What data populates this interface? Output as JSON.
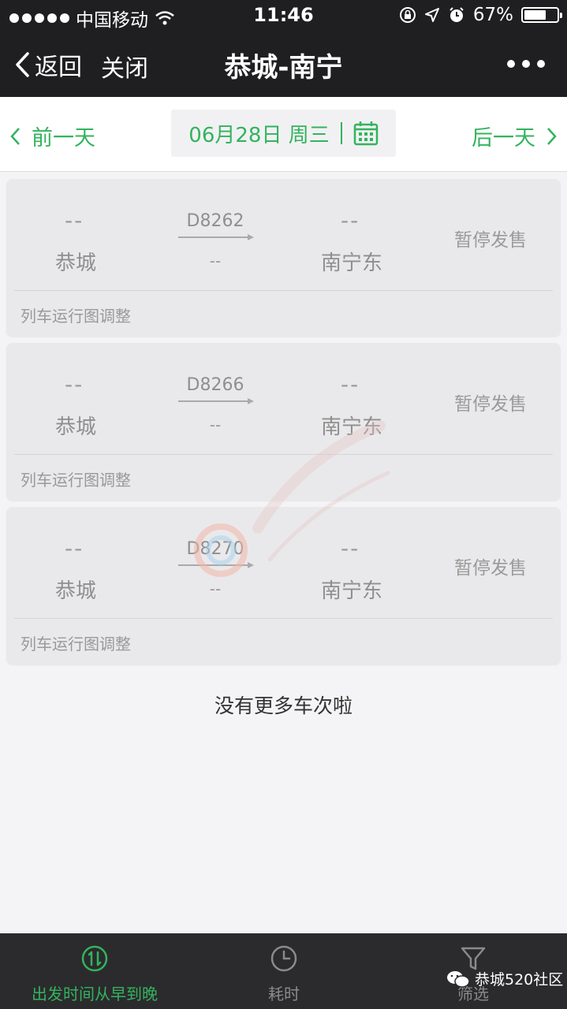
{
  "status_bar": {
    "carrier": "中国移动",
    "time": "11:46",
    "battery": "67%",
    "battery_level": 0.67
  },
  "nav": {
    "back_label": "返回",
    "close_label": "关闭",
    "title": "恭城-南宁"
  },
  "date_bar": {
    "prev_label": "前一天",
    "date_label": "06月28日 周三",
    "next_label": "后一天"
  },
  "trains": [
    {
      "dep_time": "--",
      "dep_station": "恭城",
      "train_no": "D8262",
      "duration": "--",
      "arr_time": "--",
      "arr_station": "南宁东",
      "status": "暂停发售",
      "note": "列车运行图调整"
    },
    {
      "dep_time": "--",
      "dep_station": "恭城",
      "train_no": "D8266",
      "duration": "--",
      "arr_time": "--",
      "arr_station": "南宁东",
      "status": "暂停发售",
      "note": "列车运行图调整"
    },
    {
      "dep_time": "--",
      "dep_station": "恭城",
      "train_no": "D8270",
      "duration": "--",
      "arr_time": "--",
      "arr_station": "南宁东",
      "status": "暂停发售",
      "note": "列车运行图调整"
    }
  ],
  "list_end": "没有更多车次啦",
  "bottom_tabs": {
    "sort_label": "出发时间从早到晚",
    "duration_label": "耗时",
    "filter_label": "筛选"
  },
  "watermark": {
    "badge_text": "恭城520社区"
  },
  "colors": {
    "accent": "#33b35e",
    "topbar": "#1f1f21",
    "bottombar": "#2b2b2d"
  }
}
